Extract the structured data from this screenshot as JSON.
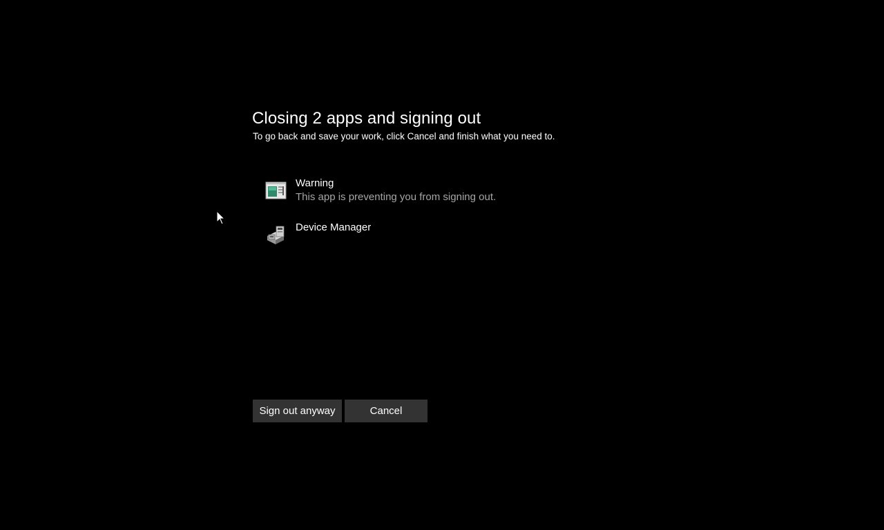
{
  "dialog": {
    "title": "Closing 2 apps and signing out",
    "subtitle": "To go back and save your work, click Cancel and finish what you need to."
  },
  "apps": [
    {
      "name": "Warning",
      "status": "This app is preventing you from signing out.",
      "icon": "application-window-icon"
    },
    {
      "name": "Device Manager",
      "status": "",
      "icon": "device-manager-icon"
    }
  ],
  "buttons": {
    "sign_out": "Sign out anyway",
    "cancel": "Cancel"
  },
  "colors": {
    "background": "#000000",
    "text_primary": "#ffffff",
    "text_secondary": "#a6a6a6",
    "button_bg": "#333333"
  }
}
